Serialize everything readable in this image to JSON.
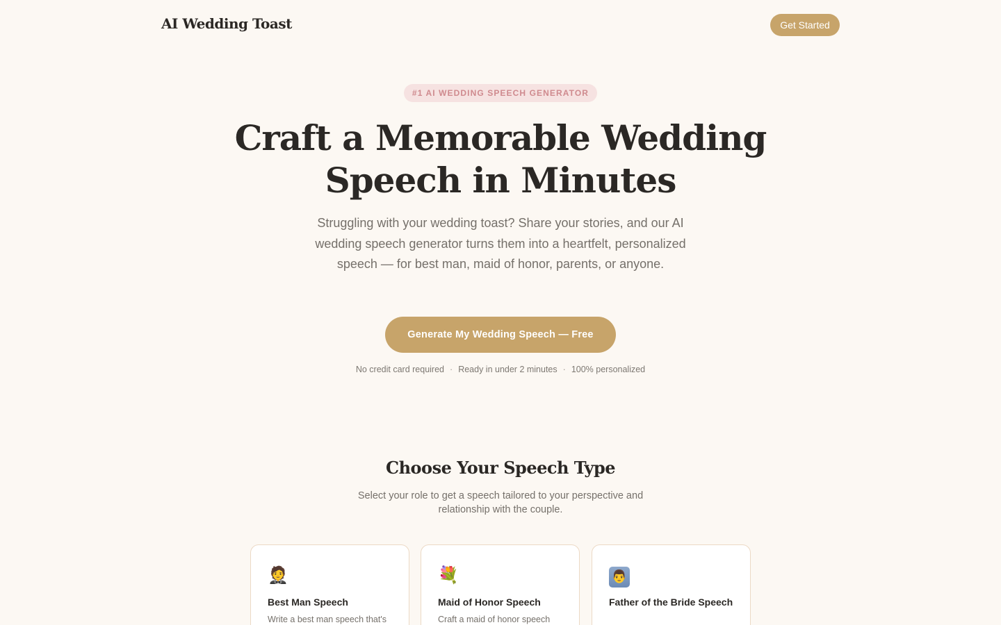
{
  "nav": {
    "logo": "AI Wedding Toast",
    "cta_label": "Get Started"
  },
  "hero": {
    "badge": "#1 AI WEDDING SPEECH GENERATOR",
    "title_line1": "Craft a Memorable Wedding",
    "title_line2": "Speech in Minutes",
    "subtitle": "Struggling with your wedding toast? Share your stories, and our AI wedding speech generator turns them into a heartfelt, personalized speech — for best man, maid of honor, parents, or anyone.",
    "cta_label": "Generate My Wedding Speech — Free",
    "features": [
      "No credit card required",
      "Ready in under 2 minutes",
      "100% personalized"
    ],
    "feature_separator": "·"
  },
  "speech_types": {
    "title": "Choose Your Speech Type",
    "subtitle": "Select your role to get a speech tailored to your perspective and relationship with the couple.",
    "cards": [
      {
        "icon": "🤵",
        "icon_name": "groom-icon",
        "title": "Best Man Speech",
        "desc": "Write a best man speech that's"
      },
      {
        "icon": "💐",
        "icon_name": "bouquet-icon",
        "title": "Maid of Honor Speech",
        "desc": "Craft a maid of honor speech"
      },
      {
        "icon": "👨",
        "icon_name": "father-icon",
        "title": "Father of the Bride Speech",
        "desc": ""
      }
    ]
  },
  "colors": {
    "background": "#fcf8f3",
    "accent": "#c7a46a",
    "badge_bg": "#f6e2e1",
    "badge_text": "#cf8a8e"
  }
}
